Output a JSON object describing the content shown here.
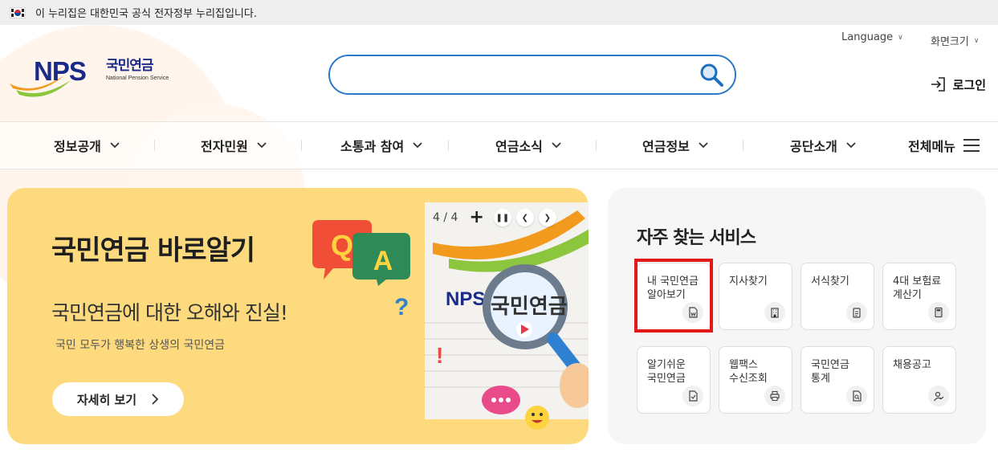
{
  "gov_banner": {
    "text": "이 누리집은 대한민국 공식 전자정부 누리집입니다."
  },
  "logo": {
    "abbr": "NPS",
    "name_ko": "국민연금",
    "name_en": "National Pension Service"
  },
  "search": {
    "placeholder": ""
  },
  "utility": {
    "language": "Language",
    "font_size": "화면크기",
    "login": "로그인"
  },
  "nav": {
    "items": [
      "정보공개",
      "전자민원",
      "소통과 참여",
      "연금소식",
      "연금정보",
      "공단소개"
    ],
    "all_menu": "전체메뉴"
  },
  "banner": {
    "title": "국민연금 바로알기",
    "subtitle": "국민연금에 대한 오해와 진실!",
    "description": "국민 모두가 행복한 상생의 국민연금",
    "more_button": "자세히 보기",
    "slide_counter": "4 / 4",
    "qa_letters": [
      "Q",
      "A"
    ],
    "art_text": "국민연금",
    "art_abbr": "NPS"
  },
  "services": {
    "title": "자주 찾는 서비스",
    "items": [
      {
        "label": "내 국민연금\n알아보기",
        "icon": "document-won-icon"
      },
      {
        "label": "지사찾기",
        "icon": "building-icon"
      },
      {
        "label": "서식찾기",
        "icon": "clipboard-icon"
      },
      {
        "label": "4대 보험료\n계산기",
        "icon": "calculator-icon"
      },
      {
        "label": "알기쉬운\n국민연금",
        "icon": "document-check-icon"
      },
      {
        "label": "웹팩스\n수신조회",
        "icon": "printer-icon"
      },
      {
        "label": "국민연금\n통계",
        "icon": "document-search-icon"
      },
      {
        "label": "채용공고",
        "icon": "user-icon"
      }
    ]
  },
  "colors": {
    "accent_blue": "#2b7ac7",
    "brand_navy": "#1a2a88",
    "banner_yellow": "#fdda7e",
    "highlight_red": "#e31818"
  }
}
